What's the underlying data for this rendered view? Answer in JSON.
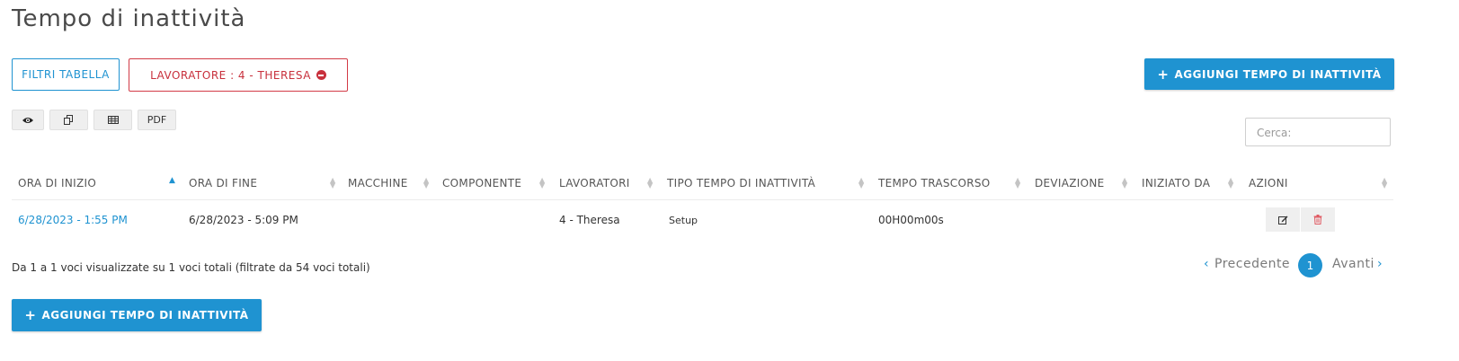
{
  "page": {
    "title": "Tempo di inattività"
  },
  "filters": {
    "table_filters_label": "FILTRI TABELLA",
    "active_filter_label": "LAVORATORE : 4 - THERESA"
  },
  "actions": {
    "add_label": "AGGIUNGI TEMPO DI INATTIVITÀ"
  },
  "toolbar": {
    "pdf_label": "PDF"
  },
  "search": {
    "placeholder": "Cerca:"
  },
  "table": {
    "columns": [
      "ORA DI INIZIO",
      "ORA DI FINE",
      "MACCHINE",
      "COMPONENTE",
      "LAVORATORI",
      "TIPO TEMPO DI INATTIVITÀ",
      "TEMPO TRASCORSO",
      "DEVIAZIONE",
      "INIZIATO DA",
      "AZIONI"
    ],
    "sorted_column": "ORA DI INIZIO",
    "rows": [
      {
        "start": "6/28/2023 - 1:55 PM",
        "end": "6/28/2023 - 5:09 PM",
        "machines": "",
        "component": "",
        "workers": "4 - Theresa",
        "type": "Setup",
        "elapsed": "00H00m00s",
        "deviation": "",
        "started_by": ""
      }
    ]
  },
  "footer": {
    "info": "Da 1 a 1 voci visualizzate su 1 voci totali (filtrate da 54 voci totali)",
    "prev_label": "Precedente",
    "next_label": "Avanti",
    "current_page": "1"
  },
  "colors": {
    "accent": "#1f93d1",
    "danger": "#c8303c"
  },
  "icons": [
    "eye-icon",
    "copy-icon",
    "table-icon",
    "edit-icon",
    "trash-icon",
    "minus-circle-icon",
    "plus-icon",
    "chevron-left-icon",
    "chevron-right-icon",
    "sort-icon"
  ]
}
